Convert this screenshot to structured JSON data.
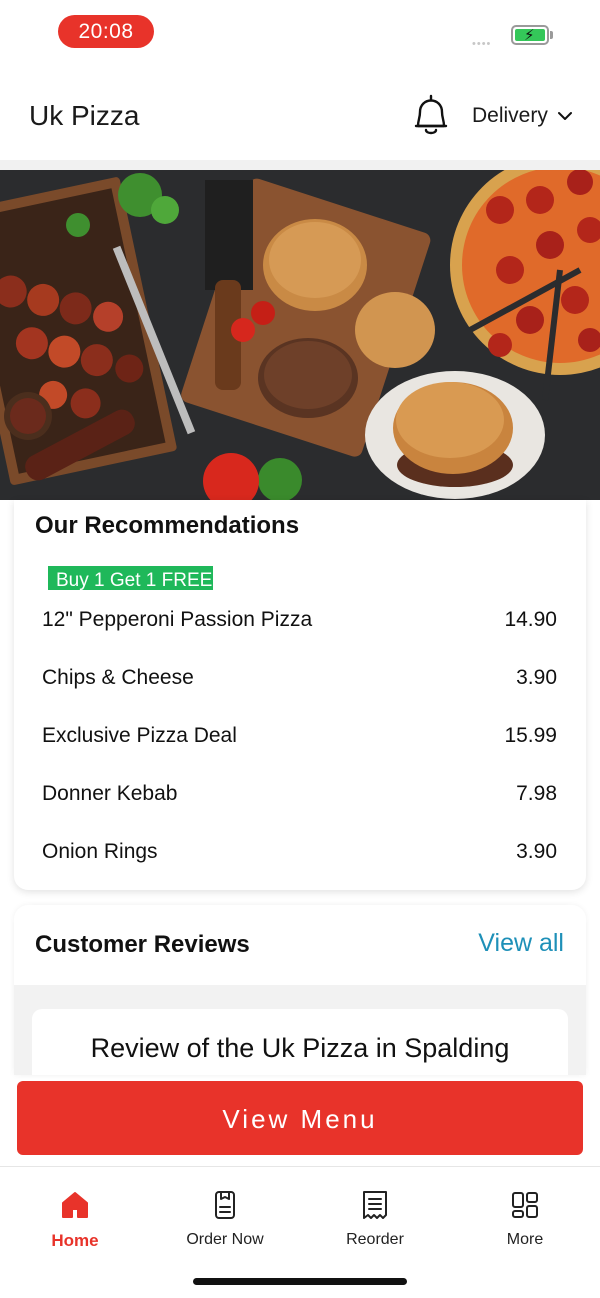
{
  "status_bar": {
    "time": "20:08",
    "signal": "••••"
  },
  "header": {
    "title": "Uk Pizza",
    "delivery_label": "Delivery"
  },
  "recommendations": {
    "title": "Our Recommendations",
    "promo_badge": "Buy 1 Get 1 FREE",
    "items": [
      {
        "name": "12\" Pepperoni Passion Pizza",
        "price": "14.90"
      },
      {
        "name": "Chips & Cheese",
        "price": "3.90"
      },
      {
        "name": "Exclusive Pizza Deal",
        "price": "15.99"
      },
      {
        "name": "Donner Kebab",
        "price": "7.98"
      },
      {
        "name": "Onion Rings",
        "price": "3.90"
      }
    ]
  },
  "reviews": {
    "title": "Customer Reviews",
    "view_all": "View all",
    "first_review_heading": "Review of the Uk Pizza in Spalding"
  },
  "cta": {
    "label": "View Menu"
  },
  "tabs": [
    {
      "label": "Home",
      "icon": "home-icon",
      "active": true
    },
    {
      "label": "Order Now",
      "icon": "order-icon",
      "active": false
    },
    {
      "label": "Reorder",
      "icon": "receipt-icon",
      "active": false
    },
    {
      "label": "More",
      "icon": "grid-icon",
      "active": false
    }
  ],
  "colors": {
    "accent": "#e8332a",
    "promo": "#1fb85a",
    "link": "#1e90b8",
    "battery": "#34c759"
  }
}
